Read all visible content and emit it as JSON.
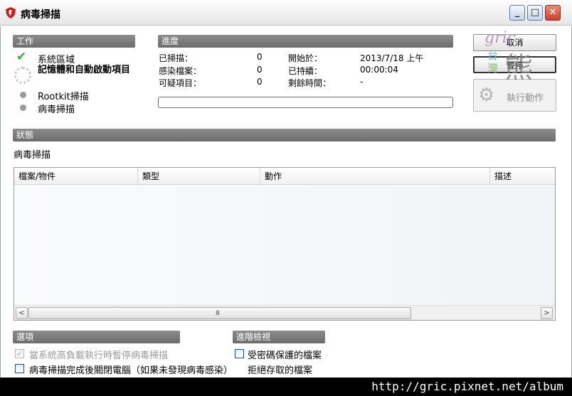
{
  "window": {
    "title": "病毒掃描",
    "minimize": "_",
    "maximize": "□",
    "close": "✕"
  },
  "work": {
    "header": "工作",
    "tasks": [
      {
        "label": "系統區域",
        "state": "done"
      },
      {
        "label": "記憶體和自動啟動項目",
        "state": "running"
      },
      {
        "label": "Rootkit掃描",
        "state": "pending"
      },
      {
        "label": "病毒掃描",
        "state": "pending"
      }
    ]
  },
  "progress": {
    "header": "進度",
    "rows": [
      {
        "label": "已掃描：",
        "value": "0",
        "label2": "開始於：",
        "value2": "2013/7/18 上午"
      },
      {
        "label": "感染檔案：",
        "value": "0",
        "label2": "已持續：",
        "value2": "00:00:04"
      },
      {
        "label": "可疑項目：",
        "value": "0",
        "label2": "剩餘時間：",
        "value2": "-"
      }
    ],
    "percent": 0
  },
  "buttons": {
    "cancel": "取消",
    "pause": "暫停",
    "action": "執行動作"
  },
  "watermark": {
    "text1": "gric",
    "text2": "台",
    "text3": "灣",
    "text4": "熊"
  },
  "status": {
    "header": "狀態",
    "current": "病毒掃描",
    "columns": [
      "檔案/物件",
      "類型",
      "動作",
      "描述"
    ],
    "rows": [],
    "scroll_left": "<",
    "scroll_right": ">",
    "scroll_grip": "III"
  },
  "options": {
    "header": "選項",
    "items": [
      {
        "label": "當系統高負載執行時暫停病毒掃描",
        "checked": true,
        "disabled": true
      },
      {
        "label": "病毒掃描完成後關閉電腦（如果未發現病毒感染）",
        "checked": false,
        "disabled": false
      }
    ]
  },
  "advanced": {
    "header": "進階檢視",
    "items": [
      {
        "label": "受密碼保護的檔案",
        "checked": false
      },
      {
        "label": "拒絕存取的檔案"
      }
    ]
  },
  "footer": {
    "url": "http://gric.pixnet.net/album"
  },
  "colors": {
    "accent": "#3aa83a",
    "bar": "#7a7a7a",
    "close": "#c9402a"
  }
}
